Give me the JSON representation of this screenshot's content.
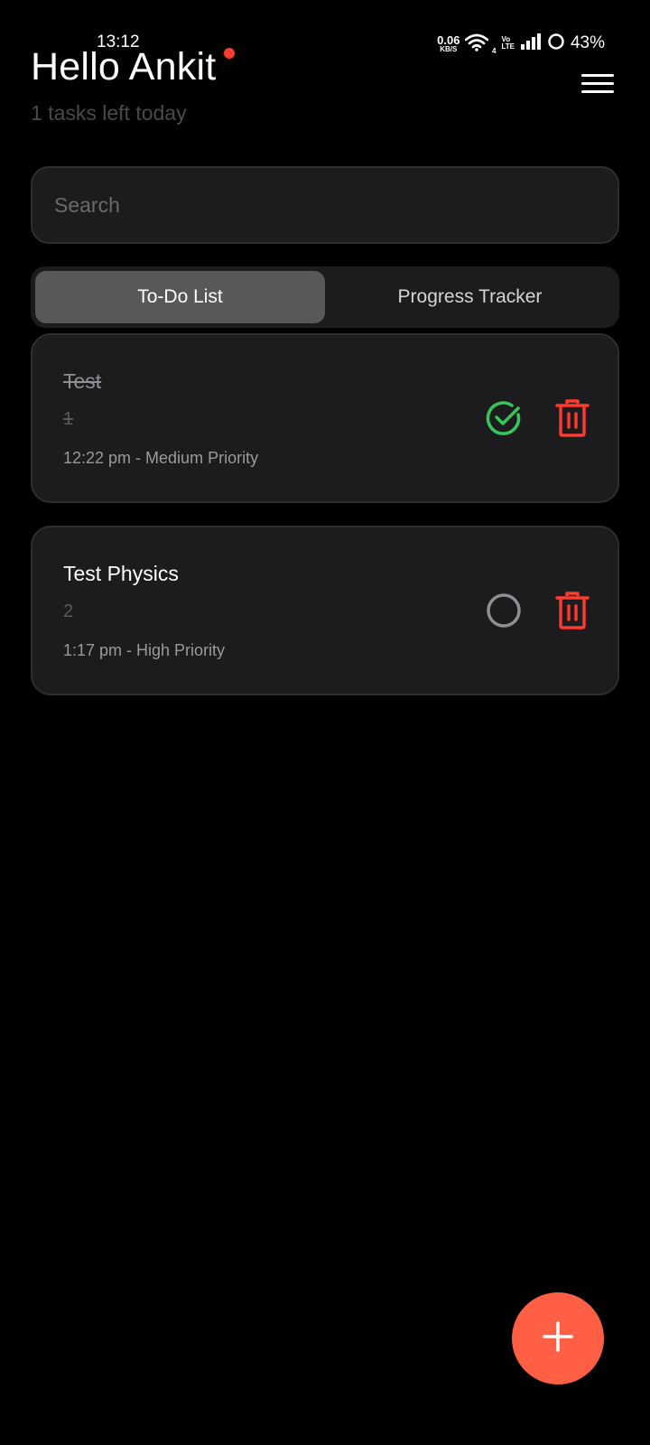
{
  "status_bar": {
    "time": "13:12",
    "net_speed": "0.06",
    "net_unit": "KB/S",
    "wifi_badge": "4",
    "volte_top": "Vo",
    "volte_bottom": "LTE",
    "battery": "43%"
  },
  "header": {
    "greeting": "Hello Ankit",
    "subtitle": "1 tasks left today",
    "menu_icon": "hamburger-icon"
  },
  "search": {
    "placeholder": "Search",
    "value": ""
  },
  "tabs": [
    {
      "label": "To-Do List",
      "active": true
    },
    {
      "label": "Progress Tracker",
      "active": false
    }
  ],
  "tasks": [
    {
      "title": "Test",
      "description": "1",
      "meta": "12:22 pm - Medium Priority",
      "completed": true,
      "status_icon": "check-circle-icon",
      "delete_icon": "trash-icon"
    },
    {
      "title": "Test Physics",
      "description": "2",
      "meta": "1:17 pm - High Priority",
      "completed": false,
      "status_icon": "empty-circle-icon",
      "delete_icon": "trash-icon"
    }
  ],
  "fab": {
    "icon": "plus-icon"
  },
  "colors": {
    "background": "#000000",
    "card": "#1c1c1e",
    "accent": "#ff5f45",
    "success": "#34c759",
    "danger": "#ff3b30",
    "notification": "#ff3b30"
  }
}
